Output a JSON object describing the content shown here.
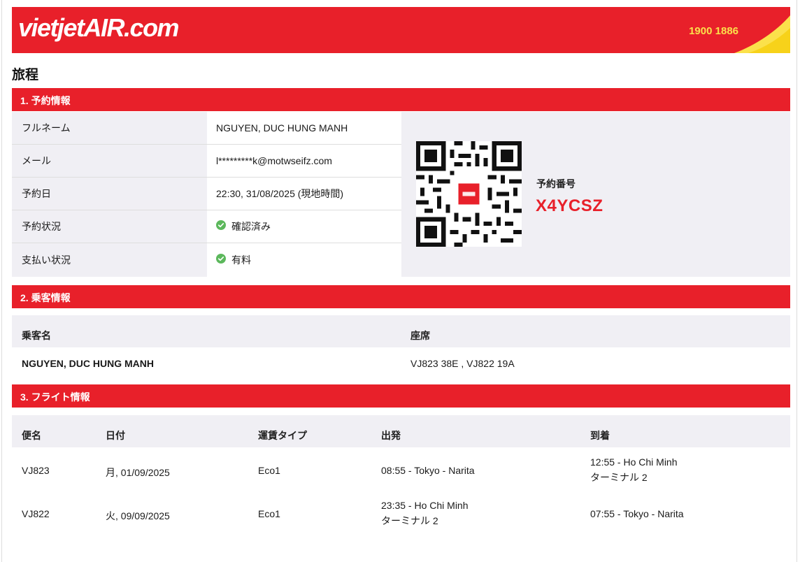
{
  "header": {
    "logo_text": "vietjetAIR.com",
    "hotline": "1900 1886",
    "colors": {
      "brand_red": "#e8202a",
      "accent_yellow": "#fbe14b",
      "panel_gray": "#f0eff4"
    }
  },
  "page_title": "旅程",
  "booking_section": {
    "title": "1. 予約情報",
    "rows": [
      {
        "label": "フルネーム",
        "value": "NGUYEN, DUC HUNG MANH"
      },
      {
        "label": "メール",
        "value": "l*********k@motwseifz.com"
      },
      {
        "label": "予約日",
        "value": "22:30, 31/08/2025 (現地時間)"
      },
      {
        "label": "予約状況",
        "value": "確認済み",
        "icon": "check-circle-icon"
      },
      {
        "label": "支払い状況",
        "value": "有料",
        "icon": "check-circle-icon"
      }
    ],
    "pnr_label": "予約番号",
    "pnr_code": "X4YCSZ"
  },
  "passenger_section": {
    "title": "2. 乗客情報",
    "headers": [
      "乗客名",
      "座席"
    ],
    "rows": [
      {
        "name": "NGUYEN, DUC HUNG MANH",
        "seats": "VJ823 38E , VJ822 19A"
      }
    ]
  },
  "flight_section": {
    "title": "3. フライト情報",
    "headers": [
      "便名",
      "日付",
      "運賃タイプ",
      "出発",
      "到着"
    ],
    "rows": [
      {
        "flight": "VJ823",
        "date": "月, 01/09/2025",
        "fare": "Eco1",
        "depart": "08:55 - Tokyo - Narita",
        "depart_terminal": "",
        "arrive": "12:55 - Ho Chi Minh",
        "arrive_terminal": "ターミナル 2"
      },
      {
        "flight": "VJ822",
        "date": "火, 09/09/2025",
        "fare": "Eco1",
        "depart": "23:35 - Ho Chi Minh",
        "depart_terminal": "ターミナル 2",
        "arrive": "07:55 - Tokyo - Narita",
        "arrive_terminal": ""
      }
    ]
  }
}
